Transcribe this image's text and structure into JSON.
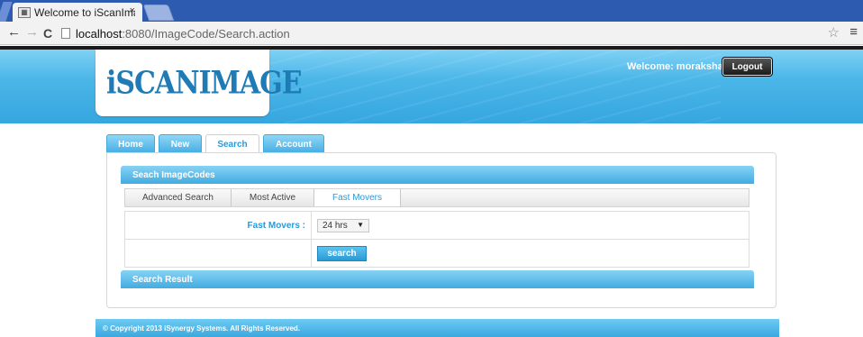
{
  "browser": {
    "tab_title": "Welcome to iScanImag",
    "tab_close": "×",
    "url_host": "localhost",
    "url_rest": ":8080/ImageCode/Search.action",
    "back_icon": "arrow-left-icon",
    "forward_icon": "arrow-right-icon",
    "reload_icon": "reload-icon",
    "star_icon": "star-icon",
    "menu_icon": "menu-icon"
  },
  "header": {
    "logo_text": "iSCANIMAGE",
    "welcome_text": "Welcome: morakshay",
    "logout_label": "Logout"
  },
  "main_tabs": [
    {
      "label": "Home"
    },
    {
      "label": "New"
    },
    {
      "label": "Search"
    },
    {
      "label": "Account"
    }
  ],
  "search_section": {
    "title": "Seach ImageCodes",
    "subtabs": [
      {
        "label": "Advanced Search"
      },
      {
        "label": "Most Active"
      },
      {
        "label": "Fast Movers"
      }
    ],
    "fast_movers_label": "Fast Movers :",
    "period_value": "24 hrs",
    "search_button_label": "search"
  },
  "result_section": {
    "title": "Search Result"
  },
  "footer": {
    "copyright": "© Copyright 2013 iSynergy Systems. All Rights Reserved."
  },
  "colors": {
    "accent": "#2a9ad6",
    "header_blue": "#4bb6e8",
    "browser_tabbar": "#2d5bb0"
  }
}
